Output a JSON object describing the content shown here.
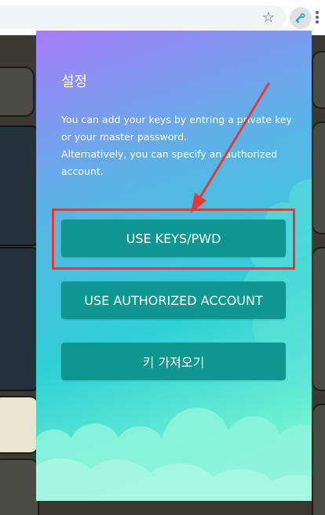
{
  "browser": {
    "star_icon": "star-icon",
    "extension_icon": "extension-icon",
    "menu_icon": "more-vert-icon"
  },
  "popup": {
    "title": "설정",
    "description_line1": "You can add your keys by entring a private key or your master password.",
    "description_line2": "Alternatively, you can specify an authorized account.",
    "buttons": {
      "use_keys": "USE KEYS/PWD",
      "use_authorized": "USE AUTHORIZED ACCOUNT",
      "import_keys": "키 가져오기"
    }
  },
  "colors": {
    "button": "#0f9690",
    "highlight": "#e53935",
    "gradient_top": "#a77cf8",
    "gradient_bottom": "#a4f6dc"
  }
}
